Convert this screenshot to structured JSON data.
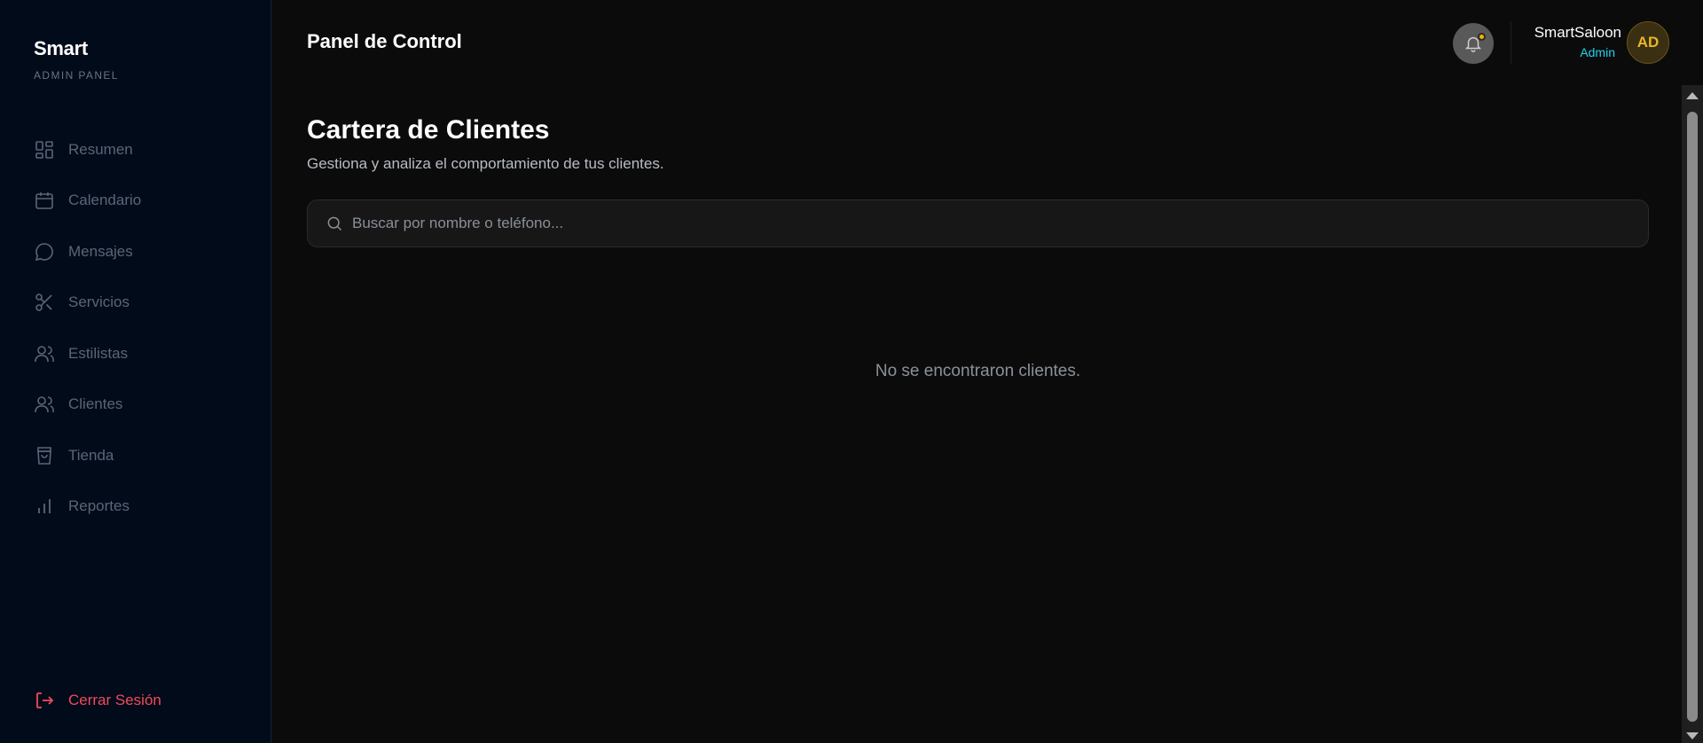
{
  "brand": {
    "title": "Smart",
    "subtitle": "ADMIN PANEL"
  },
  "sidebar": {
    "items": [
      {
        "label": "Resumen",
        "icon": "dashboard-icon"
      },
      {
        "label": "Calendario",
        "icon": "calendar-icon"
      },
      {
        "label": "Mensajes",
        "icon": "message-icon"
      },
      {
        "label": "Servicios",
        "icon": "scissors-icon"
      },
      {
        "label": "Estilistas",
        "icon": "users-icon"
      },
      {
        "label": "Clientes",
        "icon": "users-icon"
      },
      {
        "label": "Tienda",
        "icon": "shopping-bag-icon"
      },
      {
        "label": "Reportes",
        "icon": "bar-chart-icon"
      }
    ],
    "logout_label": "Cerrar Sesión"
  },
  "header": {
    "title": "Panel de Control",
    "user_name": "SmartSaloon",
    "user_role": "Admin",
    "avatar_initials": "AD"
  },
  "main": {
    "title": "Cartera de Clientes",
    "subtitle": "Gestiona y analiza el comportamiento de tus clientes.",
    "search_placeholder": "Buscar por nombre o teléfono...",
    "empty_message": "No se encontraron clientes."
  },
  "colors": {
    "sidebar_bg": "#020b1a",
    "main_bg": "#0b0b0b",
    "accent_cyan": "#22d3ee",
    "logout_red": "#f04b5a",
    "notification_dot": "#f5b301",
    "avatar_gold": "#e9b52a"
  }
}
